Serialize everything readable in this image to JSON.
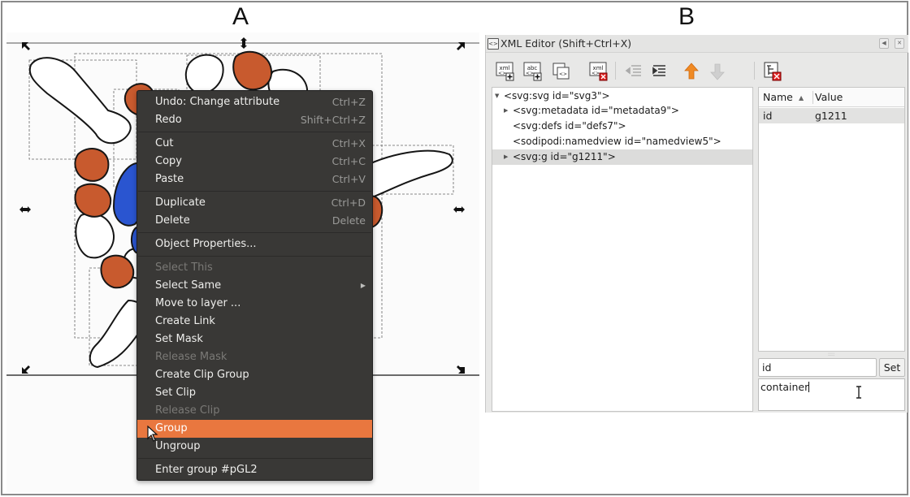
{
  "labels": {
    "panel_a": "A",
    "panel_b": "B"
  },
  "colors": {
    "shape_orange": "#c85a2e",
    "shape_blue": "#2a55d0",
    "menu_bg": "#393836",
    "menu_highlight": "#e9773f"
  },
  "context_menu": {
    "items": [
      {
        "label": "Undo: Change attribute",
        "shortcut": "Ctrl+Z",
        "disabled": false
      },
      {
        "label": "Redo",
        "shortcut": "Shift+Ctrl+Z",
        "disabled": false
      },
      {
        "label": "Cut",
        "shortcut": "Ctrl+X",
        "disabled": false
      },
      {
        "label": "Copy",
        "shortcut": "Ctrl+C",
        "disabled": false
      },
      {
        "label": "Paste",
        "shortcut": "Ctrl+V",
        "disabled": false
      },
      {
        "label": "Duplicate",
        "shortcut": "Ctrl+D",
        "disabled": false
      },
      {
        "label": "Delete",
        "shortcut": "Delete",
        "disabled": false
      },
      {
        "label": "Object Properties...",
        "shortcut": "",
        "disabled": false
      },
      {
        "label": "Select This",
        "shortcut": "",
        "disabled": true
      },
      {
        "label": "Select Same",
        "shortcut": "",
        "disabled": false,
        "submenu": true
      },
      {
        "label": "Move to layer ...",
        "shortcut": "",
        "disabled": false
      },
      {
        "label": "Create Link",
        "shortcut": "",
        "disabled": false
      },
      {
        "label": "Set Mask",
        "shortcut": "",
        "disabled": false
      },
      {
        "label": "Release Mask",
        "shortcut": "",
        "disabled": true
      },
      {
        "label": "Create Clip Group",
        "shortcut": "",
        "disabled": false
      },
      {
        "label": "Set Clip",
        "shortcut": "",
        "disabled": false
      },
      {
        "label": "Release Clip",
        "shortcut": "",
        "disabled": true
      },
      {
        "label": "Group",
        "shortcut": "",
        "disabled": false,
        "highlighted": true
      },
      {
        "label": "Ungroup",
        "shortcut": "",
        "disabled": false
      },
      {
        "label": "Enter group #pGL2",
        "shortcut": "",
        "disabled": false
      }
    ]
  },
  "xml_editor": {
    "title": "XML Editor (Shift+Ctrl+X)",
    "toolbar": [
      {
        "icon": "new-element-node-icon",
        "text": "xml"
      },
      {
        "icon": "new-text-node-icon",
        "text": "abc"
      },
      {
        "icon": "duplicate-node-icon"
      },
      {
        "icon": "delete-node-icon",
        "text": "xml"
      },
      {
        "icon": "unindent-node-icon"
      },
      {
        "icon": "indent-node-icon"
      },
      {
        "icon": "raise-node-icon"
      },
      {
        "icon": "lower-node-icon"
      },
      {
        "icon": "delete-attribute-icon"
      }
    ],
    "tree": [
      {
        "text": "<svg:svg id=\"svg3\">",
        "expander": "▼",
        "level": 0
      },
      {
        "text": "<svg:metadata id=\"metadata9\">",
        "expander": "▶",
        "level": 1
      },
      {
        "text": "<svg:defs id=\"defs7\">",
        "expander": "",
        "level": 1
      },
      {
        "text": "<sodipodi:namedview id=\"namedview5\">",
        "expander": "",
        "level": 1
      },
      {
        "text": "<svg:g id=\"g1211\">",
        "expander": "▶",
        "level": 1,
        "selected": true
      }
    ],
    "attributes": {
      "columns": {
        "name": "Name",
        "value": "Value",
        "sort_indicator": "▲"
      },
      "rows": [
        {
          "name": "id",
          "value": "g1211"
        }
      ]
    },
    "attr_name_input": "id",
    "set_button": "Set",
    "attr_value_input": "container"
  }
}
